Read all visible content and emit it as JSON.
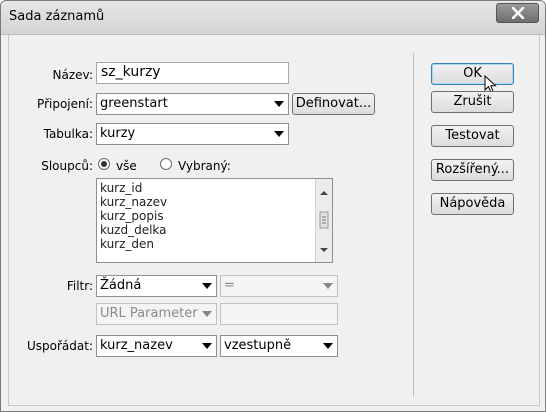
{
  "window": {
    "title": "Sada záznamů"
  },
  "labels": {
    "name": "Název:",
    "connection": "Připojení:",
    "table": "Tabulka:",
    "columns": "Sloupců:",
    "filter": "Filtr:",
    "sort": "Uspořádat:"
  },
  "name_value": "sz_kurzy",
  "connection": {
    "value": "greenstart",
    "define_label": "Definovat..."
  },
  "table": {
    "value": "kurzy"
  },
  "columns": {
    "radio_all": "vše",
    "radio_selected": "Vybraný:",
    "items": [
      "kurz_id",
      "kurz_nazev",
      "kurz_popis",
      "kuzd_delka",
      "kurz_den"
    ]
  },
  "filter": {
    "value": "Žádná",
    "operator": "=",
    "source": "URL Parameter",
    "param_value": ""
  },
  "sort": {
    "field": "kurz_nazev",
    "direction": "vzestupně"
  },
  "buttons": {
    "ok": "OK",
    "cancel": "Zrušit",
    "test": "Testovat",
    "advanced": "Rozšířený...",
    "help": "Nápověda"
  }
}
